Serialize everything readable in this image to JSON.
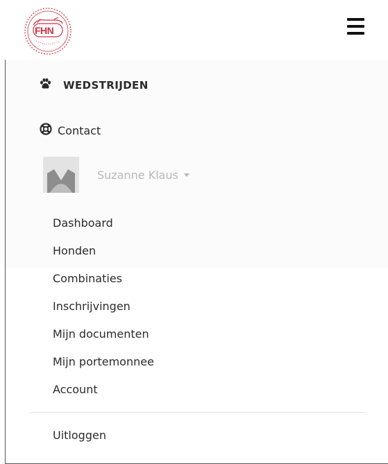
{
  "header": {
    "logo_text": "FHN"
  },
  "nav": {
    "wedstrijden_label": "WEDSTRIJDEN",
    "contact_label": "Contact"
  },
  "user": {
    "name": "Suzanne Klaus"
  },
  "submenu": {
    "items": [
      {
        "label": "Dashboard"
      },
      {
        "label": "Honden"
      },
      {
        "label": "Combinaties"
      },
      {
        "label": "Inschrijvingen"
      },
      {
        "label": "Mijn documenten"
      },
      {
        "label": "Mijn portemonnee"
      },
      {
        "label": "Account"
      }
    ]
  },
  "logout_label": "Uitloggen",
  "colors": {
    "logo_red": "#d03040",
    "muted_text": "#b8b8b8",
    "text": "#2b2b2b"
  },
  "icons": {
    "wedstrijden": "paw-icon",
    "contact": "lifebuoy-icon",
    "menu": "hamburger-icon",
    "user_caret": "caret-down-icon"
  }
}
